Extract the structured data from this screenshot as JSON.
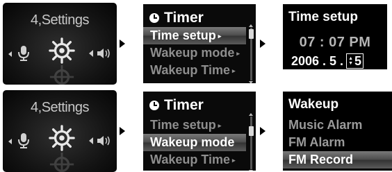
{
  "settings": {
    "title": "4,Settings"
  },
  "timer": {
    "title": "Timer",
    "items": [
      "Time setup",
      "Wakeup mode",
      "Wakeup Time"
    ]
  },
  "time_setup": {
    "title": "Time setup",
    "time": "07 : 07 PM",
    "date_prefix": "2006 . 5 .",
    "day_value": "5"
  },
  "wakeup": {
    "title": "Wakeup",
    "items": [
      "Music Alarm",
      "FM Alarm",
      "FM Record"
    ],
    "selected": "FM Record"
  },
  "icons": [
    "mic-icon",
    "gear-icon",
    "speaker-icon",
    "clock-icon"
  ]
}
